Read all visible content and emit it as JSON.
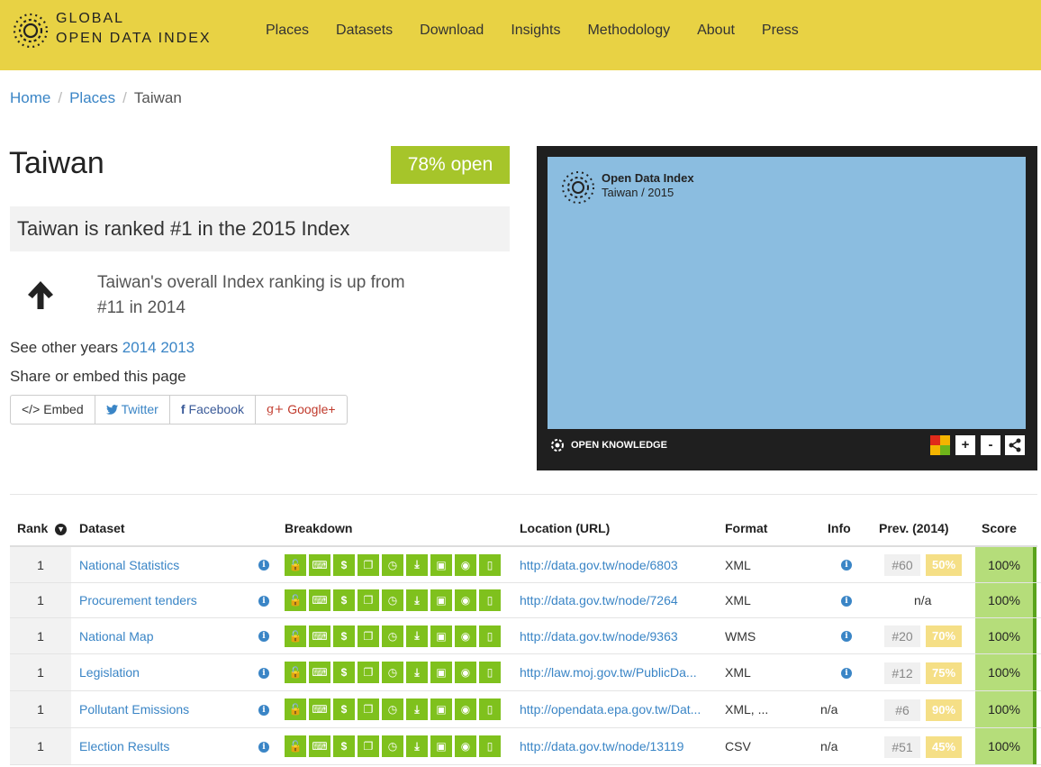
{
  "brand": {
    "line1": "GLOBAL",
    "line2": "OPEN DATA INDEX"
  },
  "nav": [
    "Places",
    "Datasets",
    "Download",
    "Insights",
    "Methodology",
    "About",
    "Press"
  ],
  "breadcrumb": {
    "home": "Home",
    "places": "Places",
    "current": "Taiwan",
    "sep": "/"
  },
  "place": {
    "name": "Taiwan",
    "open_badge": "78% open",
    "ranked_text": "Taiwan is ranked #1 in the 2015 Index",
    "change_line1": "Taiwan's overall Index ranking is up from",
    "change_line2": "#11 in 2014",
    "other_years_label": "See other years",
    "year_2014": "2014",
    "year_2013": "2013",
    "share_label": "Share or embed this page"
  },
  "share_buttons": {
    "embed": "Embed",
    "twitter": "Twitter",
    "facebook": "Facebook",
    "google": "Google+"
  },
  "map": {
    "title": "Open Data Index",
    "subtitle": "Taiwan / 2015",
    "footer": "OPEN KNOWLEDGE",
    "plus": "+",
    "minus": "-"
  },
  "table": {
    "headers": {
      "rank": "Rank",
      "dataset": "Dataset",
      "breakdown": "Breakdown",
      "location": "Location (URL)",
      "format": "Format",
      "info": "Info",
      "prev": "Prev. (2014)",
      "score": "Score"
    },
    "breakdown_icons": [
      "unlock-icon",
      "keyboard-icon",
      "dollar-icon",
      "copy-icon",
      "clock-icon",
      "download-icon",
      "save-icon",
      "eye-icon",
      "file-icon"
    ],
    "rows": [
      {
        "rank": "1",
        "dataset": "National Statistics",
        "url": "http://data.gov.tw/node/6803",
        "format": "XML",
        "info": "i",
        "prev_rank": "#60",
        "prev_score": "50%",
        "prev_na": "",
        "score": "100%"
      },
      {
        "rank": "1",
        "dataset": "Procurement tenders",
        "url": "http://data.gov.tw/node/7264",
        "format": "XML",
        "info": "i",
        "prev_rank": "",
        "prev_score": "",
        "prev_na": "n/a",
        "score": "100%"
      },
      {
        "rank": "1",
        "dataset": "National Map",
        "url": "http://data.gov.tw/node/9363",
        "format": "WMS",
        "info": "i",
        "prev_rank": "#20",
        "prev_score": "70%",
        "prev_na": "",
        "score": "100%"
      },
      {
        "rank": "1",
        "dataset": "Legislation",
        "url": "http://law.moj.gov.tw/PublicDa...",
        "format": "XML",
        "info": "i",
        "prev_rank": "#12",
        "prev_score": "75%",
        "prev_na": "",
        "score": "100%"
      },
      {
        "rank": "1",
        "dataset": "Pollutant Emissions",
        "url": "http://opendata.epa.gov.tw/Dat...",
        "format": "XML, ...",
        "info": "n/a",
        "prev_rank": "#6",
        "prev_score": "90%",
        "prev_na": "",
        "score": "100%"
      },
      {
        "rank": "1",
        "dataset": "Election Results",
        "url": "http://data.gov.tw/node/13119",
        "format": "CSV",
        "info": "n/a",
        "prev_rank": "#51",
        "prev_score": "45%",
        "prev_na": "",
        "score": "100%"
      }
    ]
  }
}
